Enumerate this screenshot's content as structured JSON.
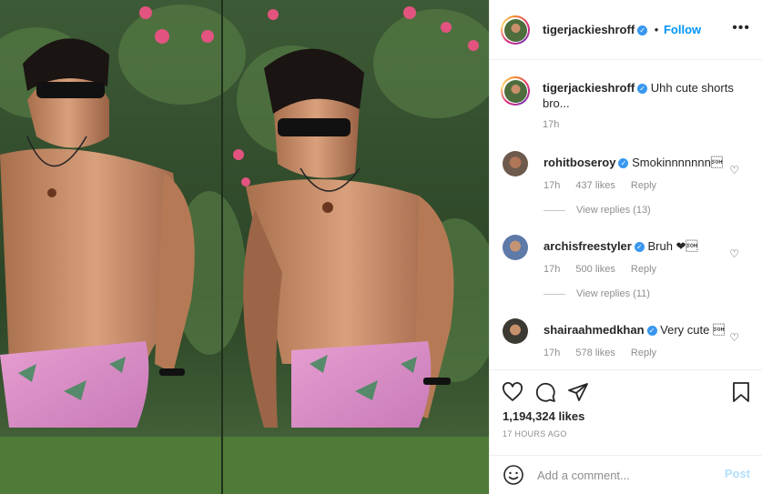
{
  "post": {
    "username": "tigerjackieshroff",
    "follow_separator": "•",
    "follow_label": "Follow",
    "more_options_glyph": "•••",
    "caption": {
      "username": "tigerjackieshroff",
      "text": "Uhh cute shorts bro...",
      "time": "17h"
    },
    "comments": [
      {
        "username": "rohitboseroy",
        "text": "Smokinnnnnnn\u0001",
        "time": "17h",
        "likes": "437 likes",
        "reply": "Reply",
        "view_replies": "View replies (13)"
      },
      {
        "username": "archisfreestyler",
        "text": "Bruh ❤\u0001",
        "time": "17h",
        "likes": "500 likes",
        "reply": "Reply",
        "view_replies": "View replies (11)"
      },
      {
        "username": "shairaahmedkhan",
        "text": "Very cute \u0001",
        "time": "17h",
        "likes": "578 likes",
        "reply": "Reply"
      }
    ],
    "like_count": "1,194,324 likes",
    "time_ago": "17 HOURS AGO",
    "add_comment_placeholder": "Add a comment...",
    "post_label": "Post",
    "icons": {
      "heart": "heart-icon",
      "comment": "comment-icon",
      "share": "share-icon",
      "save": "bookmark-icon",
      "emoji": "emoji-icon",
      "verified": "verified-badge-icon",
      "small_heart": "small-heart-icon"
    },
    "colors": {
      "link_blue": "#0095f6",
      "post_disabled": "#b2dffc",
      "verified": "#3897f0",
      "muted": "#8e8e8e"
    }
  }
}
